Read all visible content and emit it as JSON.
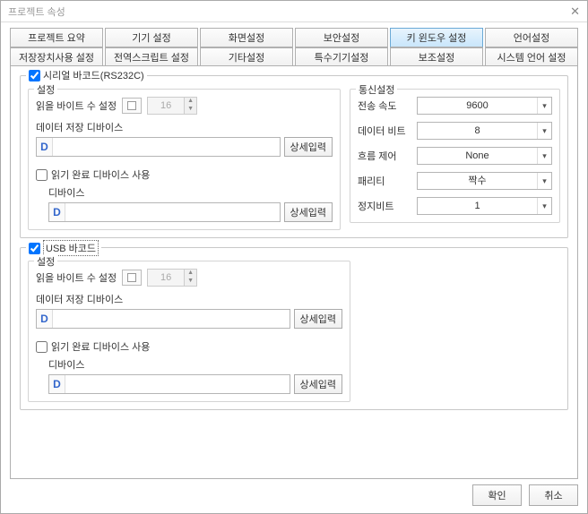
{
  "window": {
    "title": "프로젝트 속성",
    "close_icon": "✕"
  },
  "tabs": {
    "row1": {
      "summary": "프로젝트 요약",
      "device": "기기 설정",
      "screen": "화면설정",
      "security": "보안설정",
      "keywindow": "키 윈도우 설정",
      "language": "언어설정"
    },
    "row2": {
      "storage": "저장장치사용 설정",
      "globalscript": "전역스크립트 설정",
      "etc": "기타설정",
      "special": "특수기기설정",
      "aux": "보조설정",
      "syslang": "시스템 언어 설정"
    }
  },
  "serial": {
    "enabled": true,
    "title": "시리얼 바코드(RS232C)",
    "settings": {
      "legend": "설정",
      "bytes_label": "읽을 바이트 수 설정",
      "bytes_value": "16",
      "storage_label": "데이터 저장 디바이스",
      "storage_prefix": "D",
      "storage_value": "",
      "detail_btn": "상세입력",
      "readdone_enabled": false,
      "readdone_label": "읽기 완료 디바이스 사용",
      "device_label": "디바이스",
      "device_prefix": "D",
      "device_value": ""
    },
    "comm": {
      "legend": "통신설정",
      "baud_label": "전송 속도",
      "baud_value": "9600",
      "data_label": "데이터 비트",
      "data_value": "8",
      "flow_label": "흐름 제어",
      "flow_value": "None",
      "parity_label": "패리티",
      "parity_value": "짝수",
      "stop_label": "정지비트",
      "stop_value": "1"
    }
  },
  "usb": {
    "enabled": true,
    "title": "USB 바코드",
    "settings": {
      "legend": "설정",
      "bytes_label": "읽을 바이트 수 설정",
      "bytes_value": "16",
      "storage_label": "데이터 저장 디바이스",
      "storage_prefix": "D",
      "storage_value": "",
      "detail_btn": "상세입력",
      "readdone_enabled": false,
      "readdone_label": "읽기 완료 디바이스 사용",
      "device_label": "디바이스",
      "device_prefix": "D",
      "device_value": ""
    }
  },
  "footer": {
    "ok": "확인",
    "cancel": "취소"
  }
}
